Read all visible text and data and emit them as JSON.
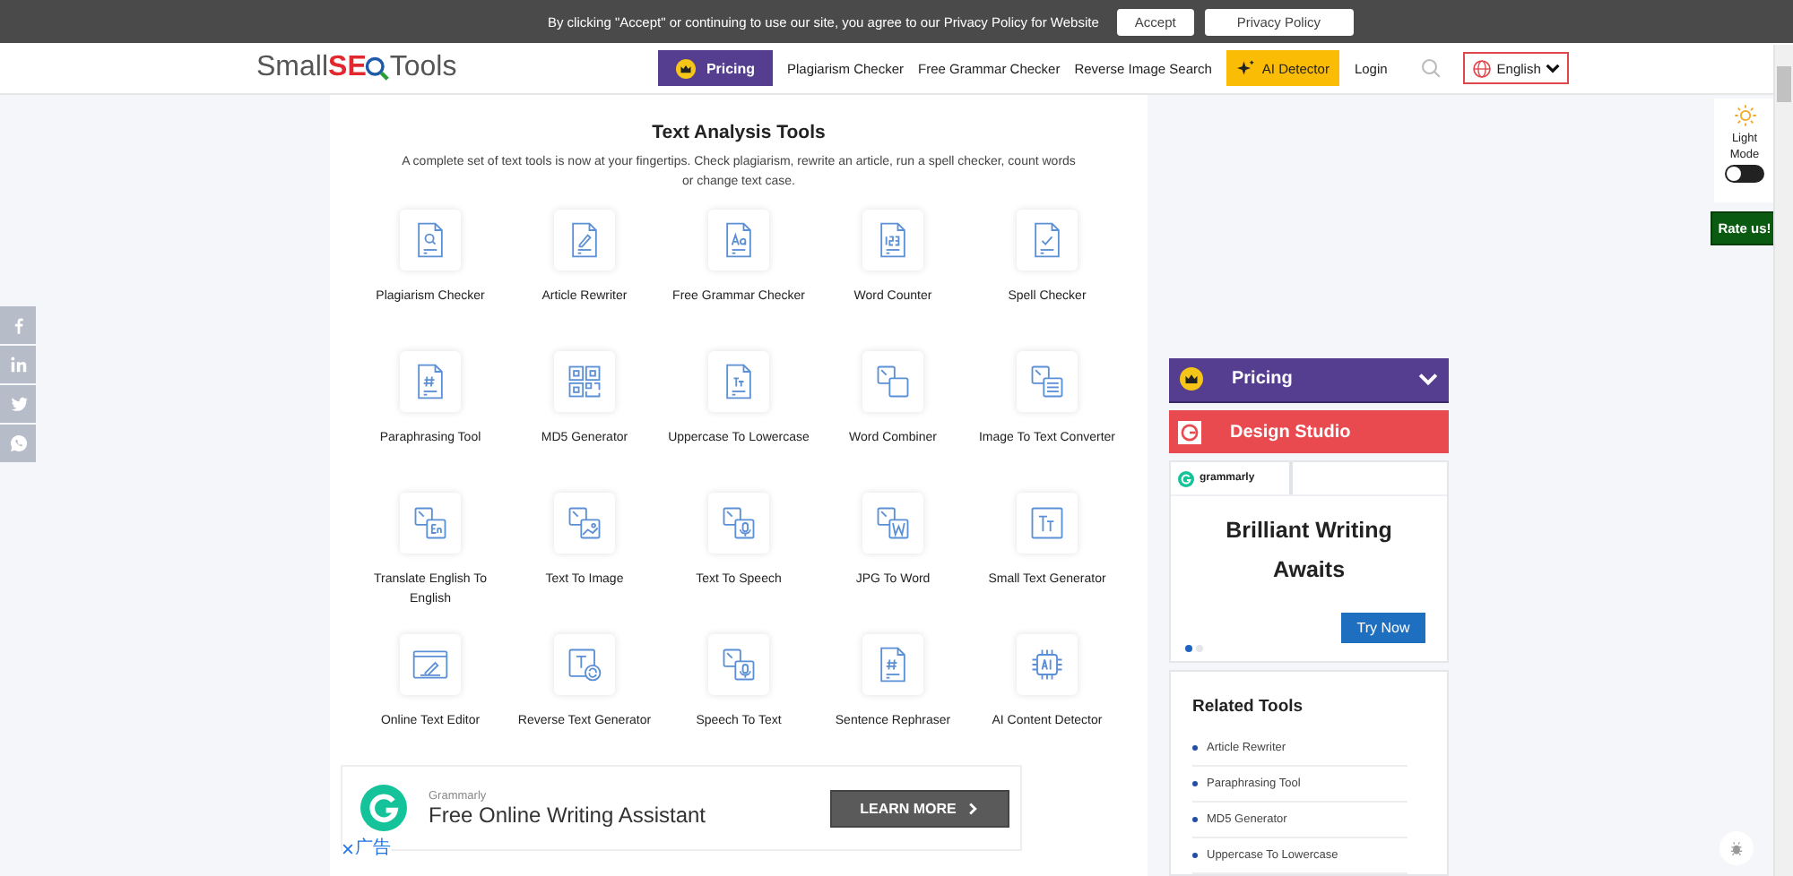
{
  "cookie_bar": {
    "message": "By clicking \"Accept\" or continuing to use our site, you agree to our Privacy Policy for Website",
    "buttons": [
      "Accept",
      "Privacy Policy"
    ]
  },
  "header": {
    "logo": [
      {
        "text": "Small",
        "kind": "plain"
      },
      {
        "text": "SE",
        "kind": "accent"
      },
      {
        "text": "Tools",
        "kind": "plain"
      }
    ],
    "nav": [
      {
        "label": "Pricing",
        "kind": "pricing"
      },
      {
        "label": "Plagiarism Checker",
        "kind": "link"
      },
      {
        "label": "Free Grammar Checker",
        "kind": "link"
      },
      {
        "label": "Reverse Image Search",
        "kind": "link"
      },
      {
        "label": "AI Detector",
        "kind": "ai"
      },
      {
        "label": "Login",
        "kind": "link"
      }
    ],
    "language": "English"
  },
  "tools_section": {
    "title": "Text Analysis Tools",
    "description": "A complete set of text tools is now at your fingertips. Check plagiarism, rewrite an article, run a spell checker, count words or change text case.",
    "tools": [
      {
        "label": "Plagiarism Checker"
      },
      {
        "label": "Article Rewriter"
      },
      {
        "label": "Free Grammar Checker"
      },
      {
        "label": "Word Counter"
      },
      {
        "label": "Spell Checker"
      },
      {
        "label": "Paraphrasing Tool"
      },
      {
        "label": "MD5 Generator"
      },
      {
        "label": "Uppercase To Lowercase"
      },
      {
        "label": "Word Combiner"
      },
      {
        "label": "Image To Text Converter"
      },
      {
        "label": "Translate English To English"
      },
      {
        "label": "Text To Image"
      },
      {
        "label": "Text To Speech"
      },
      {
        "label": "JPG To Word"
      },
      {
        "label": "Small Text Generator"
      },
      {
        "label": "Online Text Editor"
      },
      {
        "label": "Reverse Text Generator"
      },
      {
        "label": "Speech To Text"
      },
      {
        "label": "Sentence Rephraser"
      },
      {
        "label": "AI Content Detector"
      }
    ]
  },
  "bottom_ad": {
    "brand": "Grammarly",
    "headline": "Free Online Writing Assistant",
    "button": "LEARN MORE",
    "ad_label": "广告"
  },
  "sidebar": {
    "pricing": "Pricing",
    "design_studio": "Design Studio",
    "ad": {
      "brand": "grammarly",
      "headline": "Brilliant Writing Awaits",
      "button": "Try Now",
      "dots": [
        {
          "selected": true
        },
        {
          "selected": false
        }
      ]
    },
    "related": {
      "title": "Related Tools",
      "items": [
        "Article Rewriter",
        "Paraphrasing Tool",
        "MD5 Generator",
        "Uppercase To Lowercase"
      ]
    }
  },
  "theme_toggle": {
    "label": "Light Mode",
    "on": false
  },
  "rate_button": "Rate us!"
}
